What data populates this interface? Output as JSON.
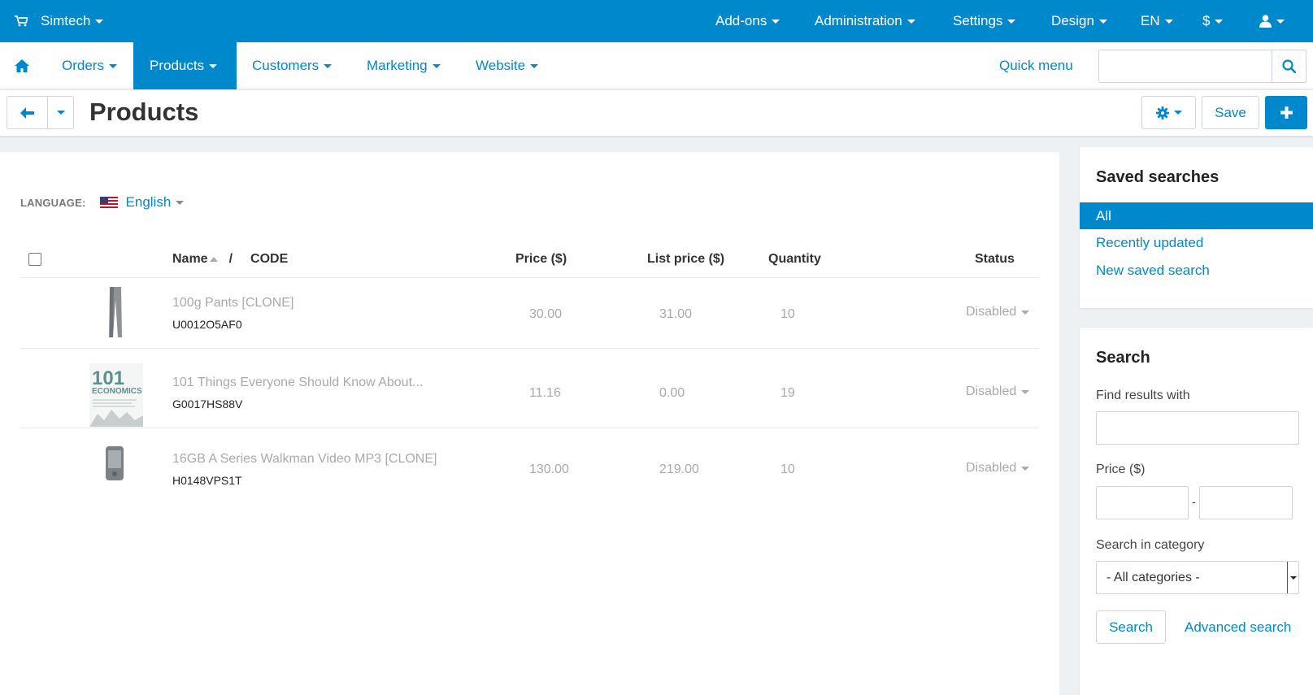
{
  "topbar": {
    "brand": "Simtech",
    "menus": [
      "Add-ons",
      "Administration",
      "Settings",
      "Design",
      "EN",
      "$"
    ],
    "icons": {
      "cart": "cart-icon",
      "user": "user-icon"
    }
  },
  "nav": {
    "items": [
      "Orders",
      "Products",
      "Customers",
      "Marketing",
      "Website"
    ],
    "active": "Products",
    "quick_menu": "Quick menu",
    "search_value": ""
  },
  "titlebar": {
    "title": "Products",
    "save": "Save"
  },
  "language": {
    "label": "LANGUAGE:",
    "value": "English"
  },
  "table": {
    "headers": {
      "name": "Name",
      "slash": "/",
      "code": "CODE",
      "price": "Price ($)",
      "list_price": "List price ($)",
      "quantity": "Quantity",
      "status": "Status"
    },
    "rows": [
      {
        "name": "100g Pants [CLONE]",
        "code": "U0012O5AF0",
        "price": "30.00",
        "list_price": "31.00",
        "quantity": "10",
        "status": "Disabled"
      },
      {
        "name": "101 Things Everyone Should Know About...",
        "code": "G0017HS88V",
        "price": "11.16",
        "list_price": "0.00",
        "quantity": "19",
        "status": "Disabled"
      },
      {
        "name": "16GB A Series Walkman Video MP3 [CLONE]",
        "code": "H0148VPS1T",
        "price": "130.00",
        "list_price": "219.00",
        "quantity": "10",
        "status": "Disabled"
      }
    ],
    "thumb_book_title": "101",
    "thumb_book_subtitle": "ECONOMICS"
  },
  "saved_searches": {
    "title": "Saved searches",
    "items": [
      "All",
      "Recently updated",
      "New saved search"
    ],
    "active": "All"
  },
  "search": {
    "title": "Search",
    "find_label": "Find results with",
    "find_value": "",
    "price_label": "Price ($)",
    "price_from": "",
    "price_to": "",
    "dash": "-",
    "category_label": "Search in category",
    "category_value": "- All categories -",
    "search_button": "Search",
    "advanced": "Advanced search"
  },
  "colors": {
    "accent": "#0088cc",
    "muted": "#a9a9a9",
    "bg": "#eef1f4"
  }
}
